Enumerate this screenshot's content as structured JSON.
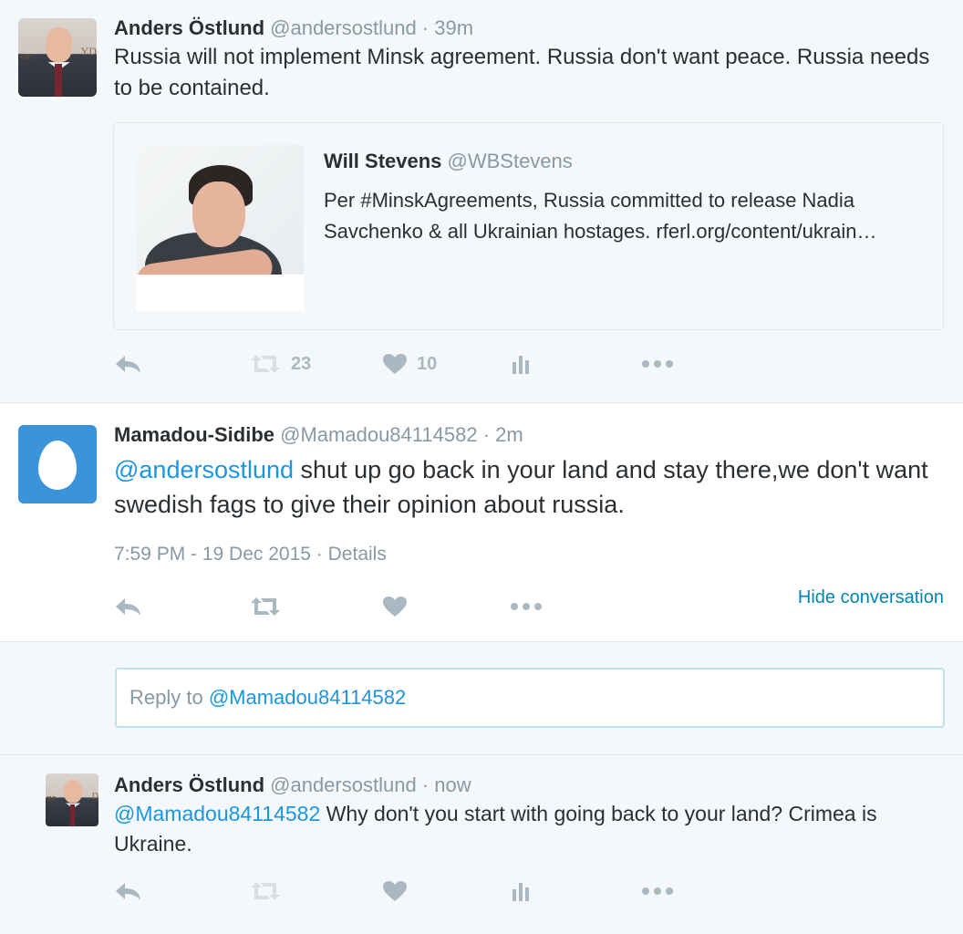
{
  "tweets": [
    {
      "name": "Anders Östlund",
      "handle": "@andersostlund",
      "sep": " · ",
      "time": "39m",
      "text": "Russia will not implement Minsk agreement. Russia don't want peace. Russia needs to be contained.",
      "avatar_logo": "ue",
      "avatar_logo2": "YD",
      "quote": {
        "name": "Will Stevens",
        "handle": "@WBStevens",
        "text": "Per #MinskAgreements, Russia committed to release Nadia Savchenko & all Ukrainian hostages. rferl.org/content/ukrain…"
      },
      "retweets": "23",
      "likes": "10"
    },
    {
      "name": "Mamadou-Sidibe",
      "handle": "@Mamadou84114582",
      "sep": " · ",
      "time": "2m",
      "mention": "@andersostlund",
      "text": " shut up go back in your land and stay there,we don't want swedish fags to give their opinion about russia.",
      "timestamp": "7:59 PM - 19 Dec 2015",
      "details_sep": " · ",
      "details": "Details",
      "hide_conversation": "Hide conversation"
    },
    {
      "name": "Anders Östlund",
      "handle": "@andersostlund",
      "sep": " · ",
      "time": "now",
      "mention": "@Mamadou84114582",
      "text": " Why don't you start with going back to your land? Crimea is Ukraine.",
      "avatar_logo": "ue",
      "avatar_logo2": "D"
    }
  ],
  "reply": {
    "prefix": "Reply to ",
    "mention": "@Mamadou84114582"
  },
  "colors": {
    "link": "#1b95e0",
    "muted": "#8899a6",
    "icon": "#aab8c2",
    "egg_bg": "#3b94d9"
  },
  "icons": [
    "reply-icon",
    "retweet-icon",
    "heart-icon",
    "analytics-icon",
    "more-icon"
  ]
}
